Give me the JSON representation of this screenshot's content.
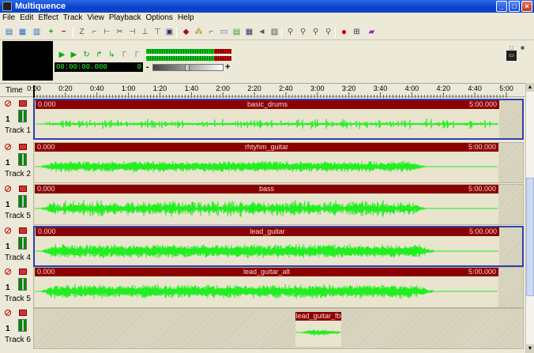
{
  "window": {
    "title": "Multiquence"
  },
  "menu": [
    "File",
    "Edit",
    "Effect",
    "Track",
    "View",
    "Playback",
    "Options",
    "Help"
  ],
  "transport": {
    "time": "00:00:00.000",
    "marker": "0",
    "vol_minus": "-",
    "vol_plus": "+"
  },
  "ruler": {
    "label": "Time",
    "ticks": [
      "0:00",
      "0:20",
      "0:40",
      "1:00",
      "1:20",
      "1:40",
      "2:00",
      "2:20",
      "2:40",
      "3:00",
      "3:20",
      "3:40",
      "4:00",
      "4:20",
      "4:40",
      "5:00"
    ]
  },
  "tracks": [
    {
      "num": "1",
      "name": "Track 1",
      "clip": {
        "start": "0.000",
        "name": "basic_drums",
        "end": "5:00.000"
      }
    },
    {
      "num": "1",
      "name": "Track 2",
      "clip": {
        "start": "0.000",
        "name": "rhtyhm_guitar",
        "end": "5:00.000"
      }
    },
    {
      "num": "1",
      "name": "Track 5",
      "clip": {
        "start": "0.000",
        "name": "bass",
        "end": "5:00.000"
      }
    },
    {
      "num": "1",
      "name": "Track 4",
      "clip": {
        "start": "0.000",
        "name": "lead_guitar",
        "end": "5:00.000"
      }
    },
    {
      "num": "1",
      "name": "Track 5",
      "clip": {
        "start": "0.000",
        "name": "lead_guitar_alt",
        "end": "5:00.000"
      }
    },
    {
      "num": "1",
      "name": "Track 6",
      "clip": {
        "start": "",
        "name": "lead_guitar_fb",
        "end": ""
      }
    }
  ],
  "colors": {
    "waveform": "#22ee22",
    "clip_bar": "#8a0000",
    "selection": "#3040b0"
  }
}
